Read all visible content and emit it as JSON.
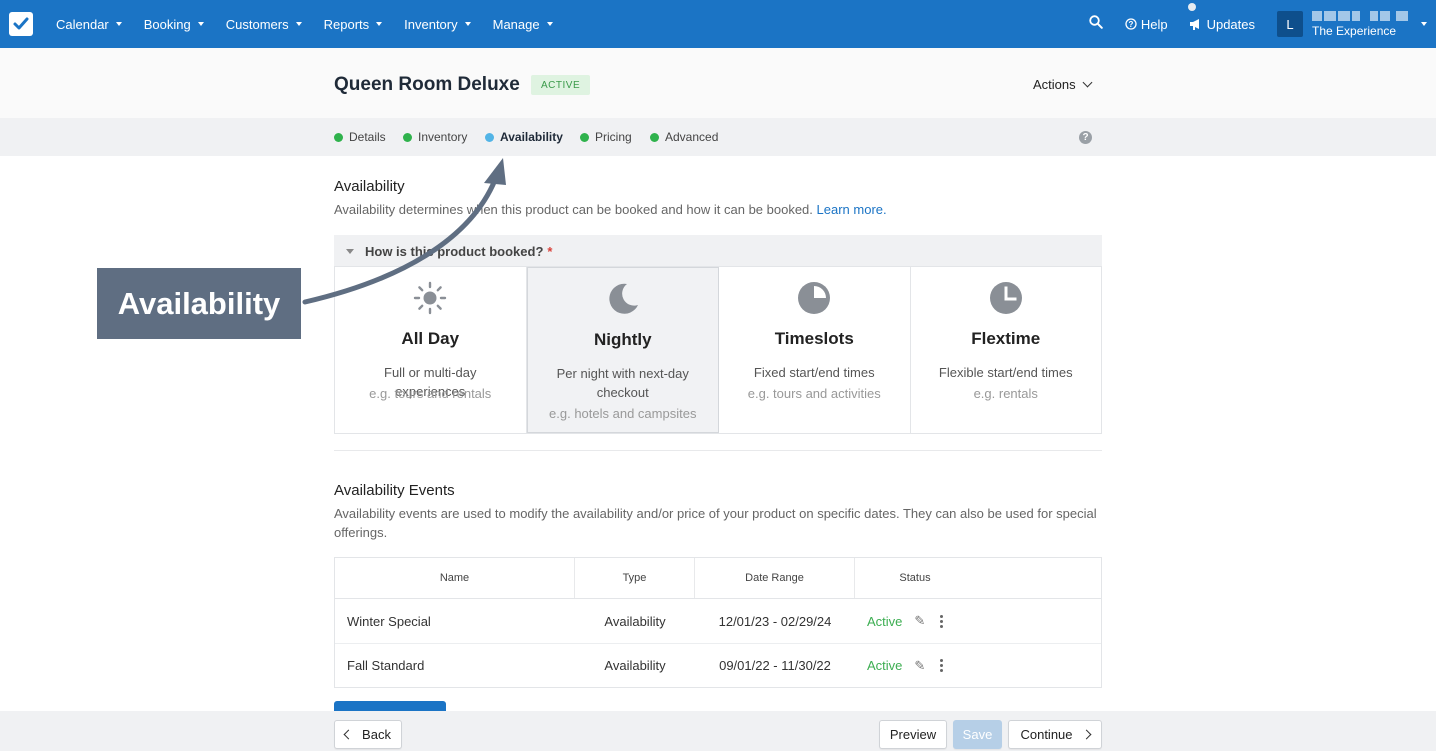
{
  "nav": {
    "items": [
      "Calendar",
      "Booking",
      "Customers",
      "Reports",
      "Inventory",
      "Manage"
    ],
    "help": "Help",
    "updates": "Updates",
    "avatar_initial": "L",
    "company": "The Experience"
  },
  "header": {
    "title": "Queen Room Deluxe",
    "status": "ACTIVE",
    "actions_label": "Actions"
  },
  "steps": [
    "Details",
    "Inventory",
    "Availability",
    "Pricing",
    "Advanced"
  ],
  "current_step": "Availability",
  "availability": {
    "title": "Availability",
    "description": "Availability determines when this product can be booked and how it can be booked.",
    "learn_more": "Learn more.",
    "question": "How is this product booked?",
    "required_mark": "*",
    "options": [
      {
        "title": "All Day",
        "desc": "Full or multi-day experiences",
        "example": "e.g. tours and rentals",
        "icon": "sun-icon"
      },
      {
        "title": "Nightly",
        "desc": "Per night with next-day checkout",
        "example": "e.g. hotels and campsites",
        "icon": "moon-icon",
        "selected": true
      },
      {
        "title": "Timeslots",
        "desc": "Fixed start/end times",
        "example": "e.g. tours and activities",
        "icon": "pie-clock-icon"
      },
      {
        "title": "Flextime",
        "desc": "Flexible start/end times",
        "example": "e.g. rentals",
        "icon": "clock-icon"
      }
    ]
  },
  "events": {
    "title": "Availability Events",
    "description": "Availability events are used to modify the availability and/or price of your product on specific dates. They can also be used for special offerings.",
    "columns": [
      "Name",
      "Type",
      "Date Range",
      "Status"
    ],
    "rows": [
      {
        "name": "Winter Special",
        "type": "Availability",
        "range": "12/01/23 - 02/29/24",
        "status": "Active"
      },
      {
        "name": "Fall Standard",
        "type": "Availability",
        "range": "09/01/22 - 11/30/22",
        "status": "Active"
      }
    ]
  },
  "footer": {
    "back": "Back",
    "preview": "Preview",
    "save": "Save",
    "continue": "Continue"
  },
  "callout": "Availability",
  "colors": {
    "nav_bg": "#1b74c5",
    "step_done": "#2fb24c",
    "step_current": "#52b4e6",
    "callout_bg": "#5f6e82"
  }
}
